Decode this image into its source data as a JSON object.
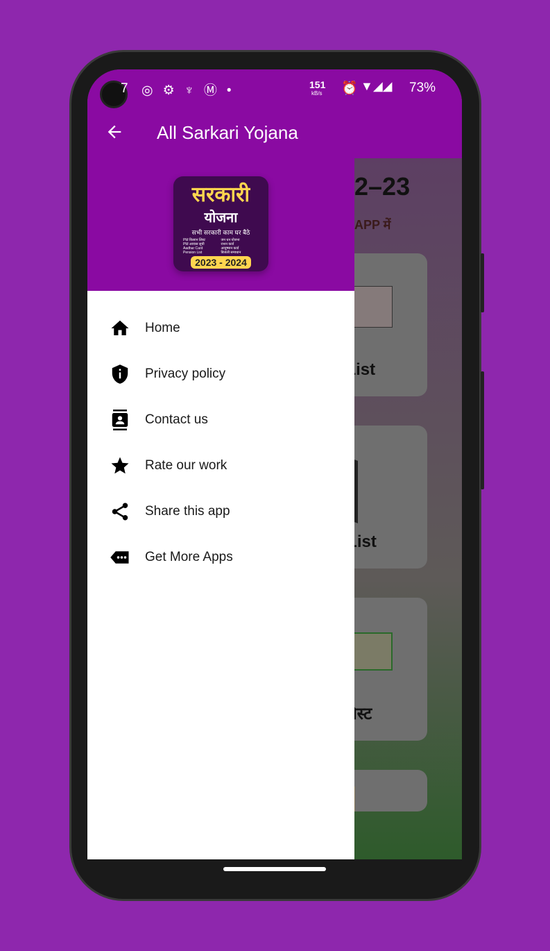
{
  "status_bar": {
    "time_partial": "7",
    "net_speed": "151",
    "net_unit": "kB/s",
    "battery": "73%"
  },
  "app_bar": {
    "title": "All Sarkari Yojana",
    "back_icon": "arrow-left-icon"
  },
  "drawer": {
    "logo": {
      "title": "सरकारी",
      "subtitle": "योजना",
      "tagline": "सभी सरकारी काम घर बैठे",
      "bullets": [
        "PM किसान लिस्ट",
        "PM आवास सूची",
        "Aadhar Card",
        "Pension List",
        "जन धन योजना",
        "राशन कार्ड",
        "आयुष्मान कार्ड",
        "बिजली समाधान"
      ],
      "years": "2023 - 2024"
    },
    "items": [
      {
        "label": "Home",
        "icon": "home-icon"
      },
      {
        "label": "Privacy policy",
        "icon": "shield-info-icon"
      },
      {
        "label": "Contact us",
        "icon": "contact-icon"
      },
      {
        "label": "Rate our work",
        "icon": "star-icon"
      },
      {
        "label": "Share this app",
        "icon": "share-icon"
      },
      {
        "label": "Get More Apps",
        "icon": "more-apps-icon"
      }
    ]
  },
  "background": {
    "heading": "2–23",
    "subheading": "APP में",
    "cards": [
      "वास List",
      "कार्ड List",
      "शन लिस्ट"
    ]
  },
  "colors": {
    "primary": "#8a0aa2",
    "page_bg": "#8e27ad",
    "logo_accent": "#ffd54f"
  }
}
